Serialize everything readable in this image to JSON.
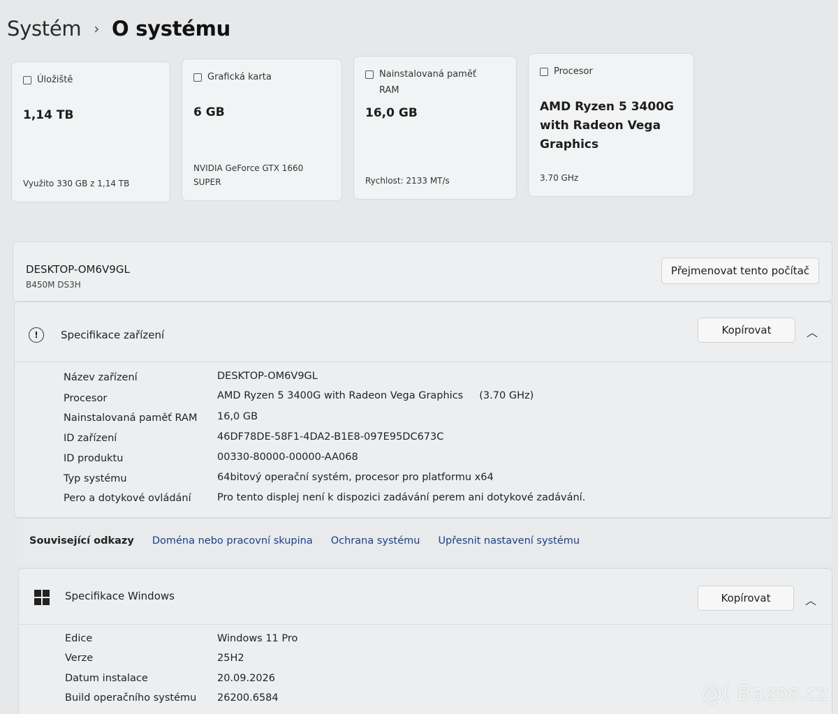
{
  "breadcrumb": {
    "parent": "Systém",
    "current": "O systému"
  },
  "cards": [
    {
      "title": "Úložiště",
      "value": "1,14 TB",
      "sub": "Využito 330 GB z 1,14 TB",
      "icon": "storage-icon"
    },
    {
      "title": "Grafická karta",
      "value": "6 GB",
      "sub_line1": "NVIDIA GeForce GTX 1660",
      "sub_line2": "SUPER",
      "icon": "gpu-icon"
    },
    {
      "title_line1": "Nainstalovaná paměť",
      "title_line2": "RAM",
      "value": "16,0 GB",
      "sub": "Rychlost: 2133 MT/s",
      "icon": "ram-icon"
    },
    {
      "title": "Procesor",
      "value_line1": "AMD Ryzen 5 3400G",
      "value_line2": "with Radeon Vega",
      "value_line3": "Graphics",
      "sub": "3.70 GHz",
      "icon": "cpu-icon"
    }
  ],
  "device": {
    "name": "DESKTOP-OM6V9GL",
    "model": "B450M DS3H",
    "rename_label": "Přejmenovat tento počítač"
  },
  "device_spec": {
    "title": "Specifikace zařízení",
    "copy_label": "Kopírovat",
    "rows": [
      {
        "label": "Název zařízení",
        "value": "DESKTOP-OM6V9GL"
      },
      {
        "label": "Procesor",
        "value": "AMD Ryzen 5 3400G with Radeon Vega Graphics     (3.70 GHz)"
      },
      {
        "label": "Nainstalovaná paměť RAM",
        "value": "16,0 GB"
      },
      {
        "label": "ID zařízení",
        "value": "46DF78DE-58F1-4DA2-B1E8-097E95DC673C"
      },
      {
        "label": "ID produktu",
        "value": "00330-80000-00000-AA068"
      },
      {
        "label": "Typ systému",
        "value": "64bitový operační systém, procesor pro platformu x64"
      },
      {
        "label": "Pero a dotykové ovládání",
        "value": "Pro tento displej není k dispozici zadávání perem ani dotykové zadávání."
      }
    ]
  },
  "related": {
    "label": "Související odkazy",
    "links": [
      "Doména nebo pracovní skupina",
      "Ochrana systému",
      "Upřesnit nastavení systému"
    ]
  },
  "windows_spec": {
    "title": "Specifikace Windows",
    "copy_label": "Kopírovat",
    "rows": [
      {
        "label": "Edice",
        "value": "Windows 11 Pro"
      },
      {
        "label": "Verze",
        "value": "25H2"
      },
      {
        "label": "Datum instalace",
        "value": "20.09.2026"
      },
      {
        "label": "Build operačního systému",
        "value": "26200.6584"
      }
    ]
  },
  "watermark": "@( Bazos.cz"
}
